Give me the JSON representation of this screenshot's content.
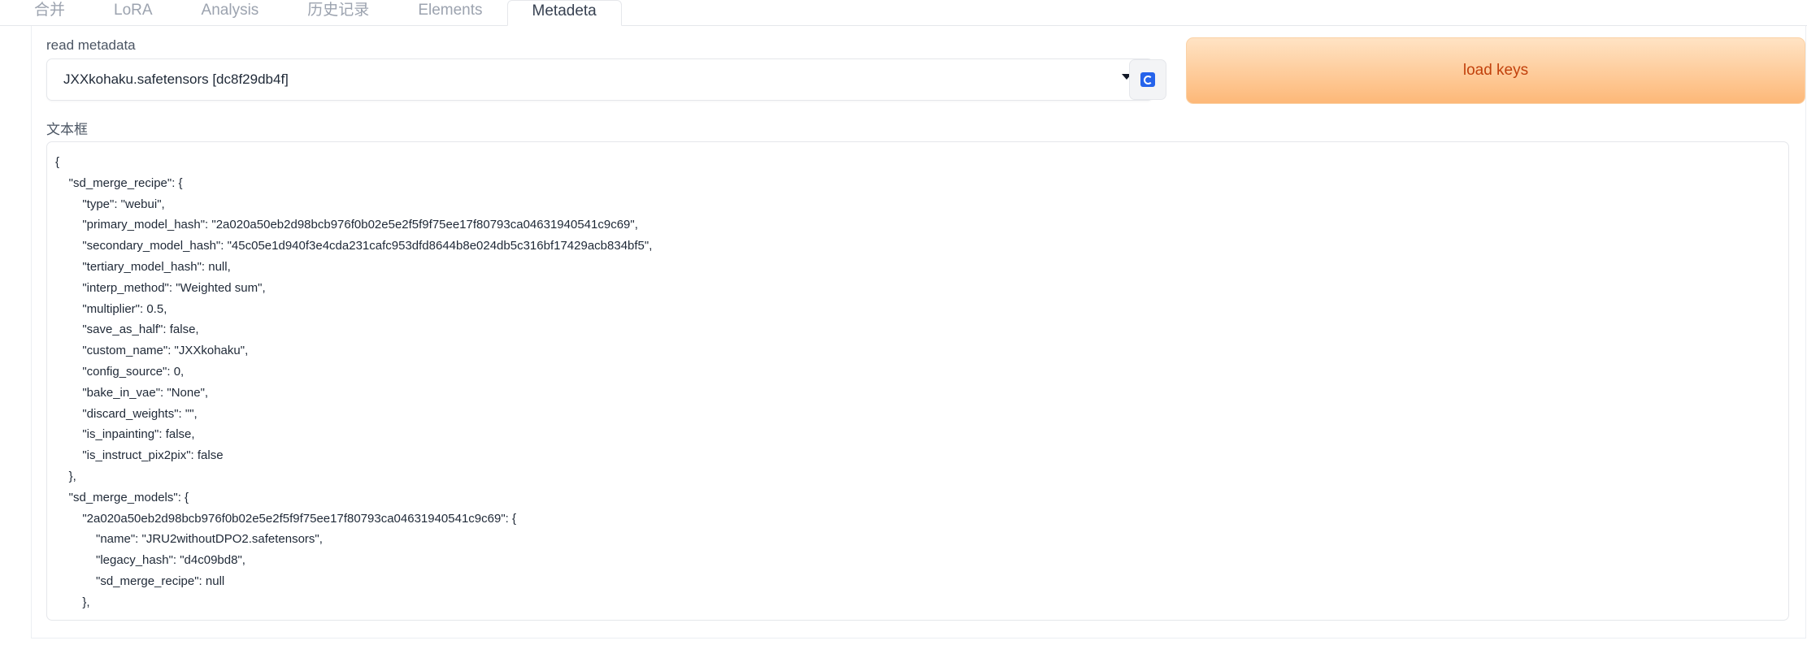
{
  "tabs": [
    {
      "label": "合并"
    },
    {
      "label": "LoRA"
    },
    {
      "label": "Analysis"
    },
    {
      "label": "历史记录"
    },
    {
      "label": "Elements"
    },
    {
      "label": "Metadeta",
      "active": true
    }
  ],
  "metadata": {
    "read_label": "read metadata",
    "selected_model": "JXXkohaku.safetensors [dc8f29db4f]",
    "load_keys_label": "load keys",
    "textbox_label": "文本框",
    "textbox_content": "{\n    \"sd_merge_recipe\": {\n        \"type\": \"webui\",\n        \"primary_model_hash\": \"2a020a50eb2d98bcb976f0b02e5e2f5f9f75ee17f80793ca04631940541c9c69\",\n        \"secondary_model_hash\": \"45c05e1d940f3e4cda231cafc953dfd8644b8e024db5c316bf17429acb834bf5\",\n        \"tertiary_model_hash\": null,\n        \"interp_method\": \"Weighted sum\",\n        \"multiplier\": 0.5,\n        \"save_as_half\": false,\n        \"custom_name\": \"JXXkohaku\",\n        \"config_source\": 0,\n        \"bake_in_vae\": \"None\",\n        \"discard_weights\": \"\",\n        \"is_inpainting\": false,\n        \"is_instruct_pix2pix\": false\n    },\n    \"sd_merge_models\": {\n        \"2a020a50eb2d98bcb976f0b02e5e2f5f9f75ee17f80793ca04631940541c9c69\": {\n            \"name\": \"JRU2withoutDPO2.safetensors\",\n            \"legacy_hash\": \"d4c09bd8\",\n            \"sd_merge_recipe\": null\n        },"
  },
  "colors": {
    "accent_text": "#c2410c",
    "button_gradient_top": "#ffe3c4",
    "button_gradient_bottom": "#fdb878",
    "refresh_icon": "#2563eb"
  },
  "icons": {
    "dropdown": "chevron-down-icon",
    "refresh": "refresh-icon"
  }
}
